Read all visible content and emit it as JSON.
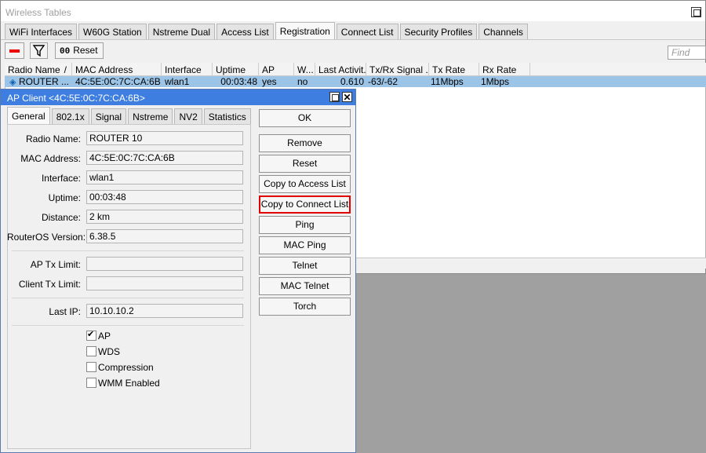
{
  "window": {
    "title": "Wireless Tables"
  },
  "tabs": [
    "WiFi Interfaces",
    "W60G Station",
    "Nstreme Dual",
    "Access List",
    "Registration",
    "Connect List",
    "Security Profiles",
    "Channels"
  ],
  "toolbar": {
    "reset_label": "Reset",
    "find_placeholder": "Find"
  },
  "table": {
    "columns": [
      "Radio Name",
      "MAC Address",
      "Interface",
      "Uptime",
      "AP",
      "W...",
      "Last Activit...",
      "Tx/Rx Signal ...",
      "Tx Rate",
      "Rx Rate"
    ],
    "sort_indicator": "/",
    "row": {
      "radio_name": "ROUTER ...",
      "mac": "4C:5E:0C:7C:CA:6B",
      "interface": "wlan1",
      "uptime": "00:03:48",
      "ap": "yes",
      "wds": "no",
      "last_activity": "0.610",
      "signal": "-63/-62",
      "tx_rate": "11Mbps",
      "rx_rate": "1Mbps"
    }
  },
  "dialog": {
    "title": "AP Client <4C:5E:0C:7C:CA:6B>",
    "tabs": [
      "General",
      "802.1x",
      "Signal",
      "Nstreme",
      "NV2",
      "Statistics"
    ],
    "fields": {
      "radio_name": {
        "label": "Radio Name:",
        "value": "ROUTER 10"
      },
      "mac": {
        "label": "MAC Address:",
        "value": "4C:5E:0C:7C:CA:6B"
      },
      "interface": {
        "label": "Interface:",
        "value": "wlan1"
      },
      "uptime": {
        "label": "Uptime:",
        "value": "00:03:48"
      },
      "distance": {
        "label": "Distance:",
        "value": "2 km"
      },
      "routeros": {
        "label": "RouterOS Version:",
        "value": "6.38.5"
      },
      "ap_tx_limit": {
        "label": "AP Tx Limit:",
        "value": ""
      },
      "client_tx_limit": {
        "label": "Client Tx Limit:",
        "value": ""
      },
      "last_ip": {
        "label": "Last IP:",
        "value": "10.10.10.2"
      }
    },
    "checkboxes": [
      {
        "label": "AP",
        "checked": true
      },
      {
        "label": "WDS",
        "checked": false
      },
      {
        "label": "Compression",
        "checked": false
      },
      {
        "label": "WMM Enabled",
        "checked": false
      }
    ],
    "buttons": {
      "ok": "OK",
      "remove": "Remove",
      "reset": "Reset",
      "copy_access": "Copy to Access List",
      "copy_connect": "Copy to Connect List",
      "ping": "Ping",
      "mac_ping": "MAC Ping",
      "telnet": "Telnet",
      "mac_telnet": "MAC Telnet",
      "torch": "Torch"
    }
  },
  "colors": {
    "selection": "#9cc4e6",
    "dialog_title": "#3d7ee0",
    "highlight_border": "#e00000"
  }
}
